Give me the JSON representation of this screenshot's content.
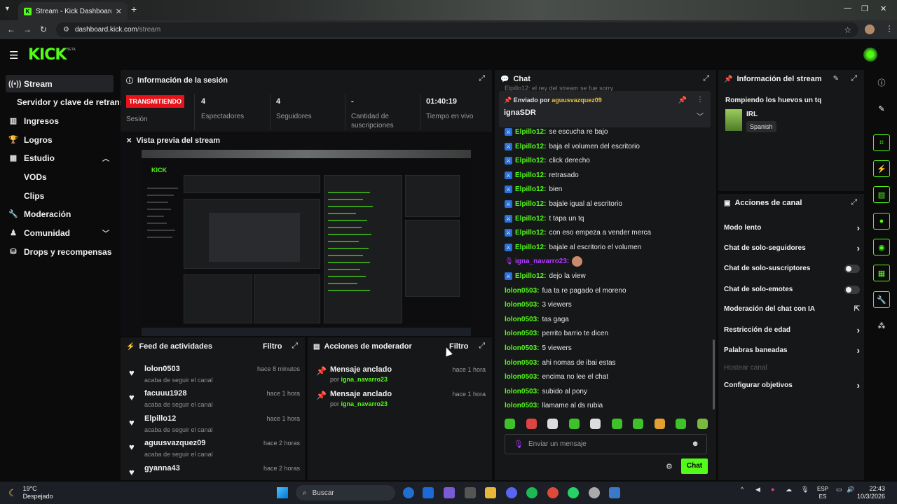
{
  "browser": {
    "tab_title": "Stream - Kick Dashboard",
    "url_host": "dashboard.kick.com",
    "url_path": "/stream"
  },
  "header": {
    "logo": "KICK",
    "beta": "BETA"
  },
  "sidebar": {
    "items": [
      {
        "label": "Stream",
        "icon": "broadcast-icon"
      },
      {
        "label": "Servidor y clave de retransmisión",
        "icon": ""
      },
      {
        "label": "Ingresos",
        "icon": "chart-icon"
      },
      {
        "label": "Logros",
        "icon": "trophy-icon"
      },
      {
        "label": "Estudio",
        "icon": "studio-icon"
      },
      {
        "label": "VODs",
        "icon": ""
      },
      {
        "label": "Clips",
        "icon": ""
      },
      {
        "label": "Moderación",
        "icon": "wrench-icon"
      },
      {
        "label": "Comunidad",
        "icon": "community-icon"
      },
      {
        "label": "Drops y recompensas",
        "icon": "drops-icon"
      }
    ]
  },
  "session": {
    "title": "Información de la sesión",
    "badge": "TRANSMITIENDO",
    "badge_label": "Sesión",
    "stats": [
      {
        "value": "4",
        "label": "Espectadores"
      },
      {
        "value": "4",
        "label": "Seguidores"
      },
      {
        "value": "-",
        "label": "Cantidad de suscripciones"
      },
      {
        "value": "01:40:19",
        "label": "Tiempo en vivo"
      }
    ]
  },
  "preview": {
    "title": "Vista previa del stream"
  },
  "activity": {
    "title": "Feed de actividades",
    "filter": "Filtro",
    "items": [
      {
        "name": "lolon0503",
        "sub": "acaba de seguir el canal",
        "time": "hace 8 minutos"
      },
      {
        "name": "facuuu1928",
        "sub": "acaba de seguir el canal",
        "time": "hace 1 hora"
      },
      {
        "name": "Elpillo12",
        "sub": "acaba de seguir el canal",
        "time": "hace 1 hora"
      },
      {
        "name": "aguusvazquez09",
        "sub": "acaba de seguir el canal",
        "time": "hace 2 horas"
      },
      {
        "name": "gyanna43",
        "sub": "",
        "time": "hace 2 horas"
      }
    ]
  },
  "modactions": {
    "title": "Acciones de moderador",
    "filter": "Filtro",
    "items": [
      {
        "name": "Mensaje anclado",
        "by": "por",
        "user": "igna_navarro23",
        "time": "hace 1 hora"
      },
      {
        "name": "Mensaje anclado",
        "by": "por",
        "user": "igna_navarro23",
        "time": "hace 1 hora"
      }
    ]
  },
  "chat": {
    "title": "Chat",
    "partial_top": "Elpillo12: el rey del stream se fue sorry",
    "pinned": {
      "prefix": "Enviado por",
      "user": "aguusvazquez09",
      "text": "ignaSDR"
    },
    "messages": [
      {
        "user": "Elpillo12",
        "color": "#53fc18",
        "badge": "mod",
        "msg": "se escucha re bajo"
      },
      {
        "user": "Elpillo12",
        "color": "#53fc18",
        "badge": "mod",
        "msg": "baja el volumen del escritorio"
      },
      {
        "user": "Elpillo12",
        "color": "#53fc18",
        "badge": "mod",
        "msg": "click derecho"
      },
      {
        "user": "Elpillo12",
        "color": "#53fc18",
        "badge": "mod",
        "msg": "retrasado"
      },
      {
        "user": "Elpillo12",
        "color": "#53fc18",
        "badge": "mod",
        "msg": "bien"
      },
      {
        "user": "Elpillo12",
        "color": "#53fc18",
        "badge": "mod",
        "msg": "bajale igual al escritorio"
      },
      {
        "user": "Elpillo12",
        "color": "#53fc18",
        "badge": "mod",
        "msg": "t tapa un tq"
      },
      {
        "user": "Elpillo12",
        "color": "#53fc18",
        "badge": "mod",
        "msg": "con eso empeza a vender merca"
      },
      {
        "user": "Elpillo12",
        "color": "#53fc18",
        "badge": "mod",
        "msg": "bajale al escritorio el volumen"
      },
      {
        "user": "igna_navarro23",
        "color": "#b13cff",
        "badge": "broadcaster",
        "msg": ""
      },
      {
        "user": "Elpillo12",
        "color": "#53fc18",
        "badge": "mod",
        "msg": "dejo la view"
      },
      {
        "user": "lolon0503",
        "color": "#53fc18",
        "badge": "",
        "msg": "fua ta re pagado el moreno"
      },
      {
        "user": "lolon0503",
        "color": "#53fc18",
        "badge": "",
        "msg": "3 viewers"
      },
      {
        "user": "lolon0503",
        "color": "#53fc18",
        "badge": "",
        "msg": "tas gaga"
      },
      {
        "user": "lolon0503",
        "color": "#53fc18",
        "badge": "",
        "msg": "perrito barrio te dicen"
      },
      {
        "user": "lolon0503",
        "color": "#53fc18",
        "badge": "",
        "msg": "5 viewers"
      },
      {
        "user": "lolon0503",
        "color": "#53fc18",
        "badge": "",
        "msg": "ahi nomas de ibai estas"
      },
      {
        "user": "lolon0503",
        "color": "#53fc18",
        "badge": "",
        "msg": "encima no lee el chat"
      },
      {
        "user": "lolon0503",
        "color": "#53fc18",
        "badge": "",
        "msg": "subido al pony"
      },
      {
        "user": "lolon0503",
        "color": "#53fc18",
        "badge": "",
        "msg": "llamame al ds rubia"
      }
    ],
    "placeholder": "Enviar un mensaje",
    "send": "Chat"
  },
  "stream_info": {
    "title": "Información del stream",
    "stream_title": "Rompiendo los huevos un tq",
    "category": "IRL",
    "language": "Spanish"
  },
  "channel_actions": {
    "title": "Acciones de canal",
    "items": [
      {
        "label": "Modo lento",
        "control": "arrow"
      },
      {
        "label": "Chat de solo-seguidores",
        "control": "arrow"
      },
      {
        "label": "Chat de solo-suscriptores",
        "control": "toggle"
      },
      {
        "label": "Chat de solo-emotes",
        "control": "toggle"
      },
      {
        "label": "Moderación del chat con IA",
        "control": "external"
      },
      {
        "label": "Restricción de edad",
        "control": "arrow"
      },
      {
        "label": "Palabras baneadas",
        "control": "arrow"
      },
      {
        "label": "Hostear canal",
        "control": "disabled"
      },
      {
        "label": "Configurar objetivos",
        "control": "arrow"
      }
    ]
  },
  "taskbar": {
    "temp": "19°C",
    "weather": "Despejado",
    "search": "Buscar",
    "lang1": "ESP",
    "lang2": "ES",
    "time": "22:43",
    "date": "10/3/2026"
  }
}
